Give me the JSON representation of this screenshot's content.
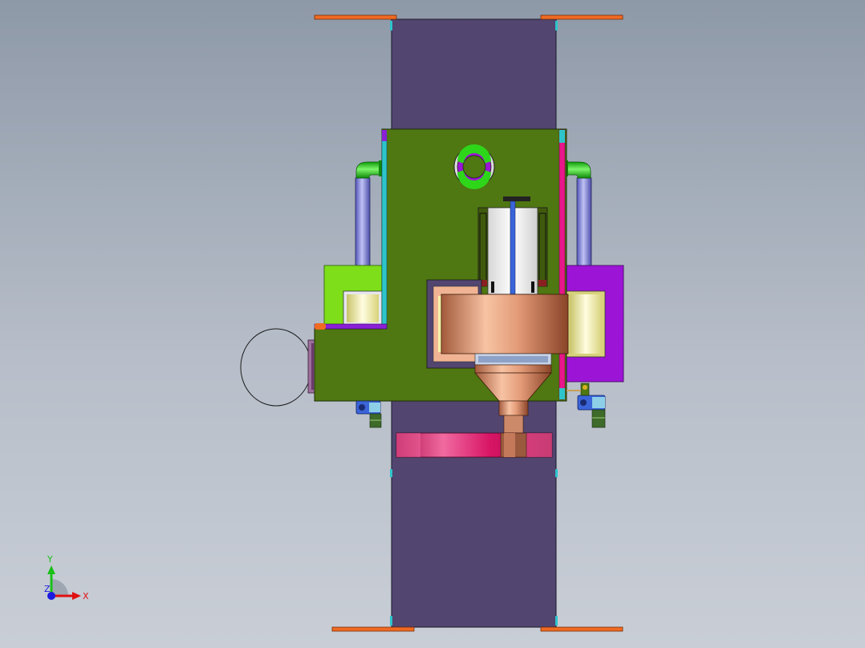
{
  "view": {
    "background_top": "#8e99a8",
    "background_bottom": "#c9ced6"
  },
  "colors": {
    "rail": "#524570",
    "rail_stop": "#f06a22",
    "main_plate": "#4f7712",
    "green_box": "#7ede1a",
    "magenta_box": "#9c14d6",
    "ring_frame": "#6b3a6b",
    "copper": "#d98e68",
    "cream": "#f5f1a8",
    "pink_band": "#e0176b",
    "pipe_blue": "#7f82d8",
    "pipe_green": "#2ed61a",
    "cyan_pipe": "#2ec4cc",
    "pink_pipe": "#e8178a",
    "valve_blue": "#3a64d8"
  },
  "triad": {
    "x_label": "X",
    "y_label": "Y",
    "z_label": "Z",
    "x_color": "#e01010",
    "y_color": "#18c018",
    "z_color": "#1a1ae0"
  },
  "icons": [
    "coordinate-triad-icon"
  ]
}
